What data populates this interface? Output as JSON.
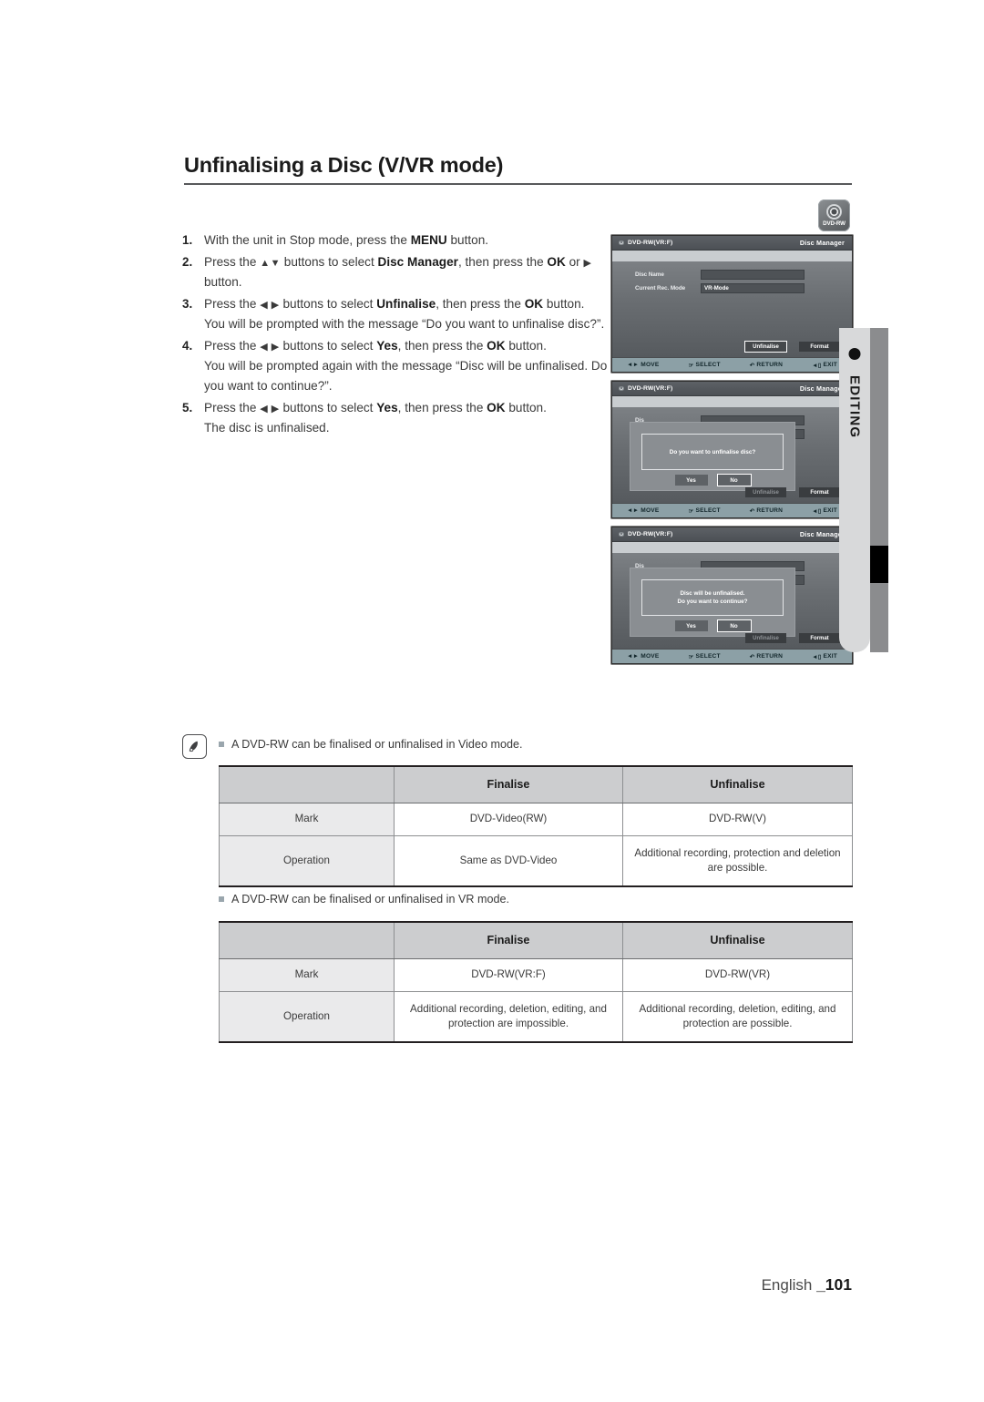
{
  "page": {
    "title": "Unfinalising a Disc (V/VR mode)",
    "footer_language": "English ",
    "footer_page": "_101"
  },
  "sidebar": {
    "label": "EDITING",
    "badge_label": "DVD-RW"
  },
  "steps": [
    {
      "num": "1.",
      "parts": [
        {
          "t": "With the unit in Stop mode, press the ",
          "b": false
        },
        {
          "t": "MENU",
          "b": true
        },
        {
          "t": " button.",
          "b": false
        }
      ]
    },
    {
      "num": "2.",
      "parts": [
        {
          "t": "Press the ",
          "b": false
        },
        {
          "t": "▲▼",
          "b": false
        },
        {
          "t": " buttons to select ",
          "b": false
        },
        {
          "t": "Disc Manager",
          "b": true
        },
        {
          "t": ", then press the ",
          "b": false
        },
        {
          "t": "OK",
          "b": true
        },
        {
          "t": " or ",
          "b": false
        },
        {
          "t": "▶",
          "b": false
        },
        {
          "t": " button.",
          "b": false
        }
      ]
    },
    {
      "num": "3.",
      "parts": [
        {
          "t": "Press the ",
          "b": false
        },
        {
          "t": "◀ ▶",
          "b": false
        },
        {
          "t": " buttons to select ",
          "b": false
        },
        {
          "t": "Unfinalise",
          "b": true
        },
        {
          "t": ", then press the ",
          "b": false
        },
        {
          "t": "OK",
          "b": true
        },
        {
          "t": " button.",
          "b": false
        },
        {
          "t": "\n",
          "b": false
        },
        {
          "t": "You will be prompted with the message “Do you want to unfinalise disc?”.",
          "b": false
        }
      ]
    },
    {
      "num": "4.",
      "parts": [
        {
          "t": "Press the ",
          "b": false
        },
        {
          "t": "◀ ▶",
          "b": false
        },
        {
          "t": " buttons to select ",
          "b": false
        },
        {
          "t": "Yes",
          "b": true
        },
        {
          "t": ", then press the ",
          "b": false
        },
        {
          "t": "OK",
          "b": true
        },
        {
          "t": " button.",
          "b": false
        },
        {
          "t": "\n",
          "b": false
        },
        {
          "t": "You will be prompted again with the message “Disc will be unfinalised. Do you want to continue?”.",
          "b": false
        }
      ]
    },
    {
      "num": "5.",
      "parts": [
        {
          "t": "Press the ",
          "b": false
        },
        {
          "t": "◀ ▶",
          "b": false
        },
        {
          "t": " buttons to select ",
          "b": false
        },
        {
          "t": "Yes",
          "b": true
        },
        {
          "t": ", then press the ",
          "b": false
        },
        {
          "t": "OK",
          "b": true
        },
        {
          "t": " button.",
          "b": false
        },
        {
          "t": "\n",
          "b": false
        },
        {
          "t": "The disc is unfinalised.",
          "b": false
        }
      ]
    }
  ],
  "screens": {
    "common": {
      "disc_label": "DVD-RW(VR:F)",
      "header_right": "Disc Manager",
      "field_disc_name_label": "Disc Name",
      "field_disc_name_value": "",
      "field_rec_mode_label": "Current Rec. Mode",
      "field_rec_mode_value": "VR-Mode",
      "btn_unfinalise": "Unfinalise",
      "btn_format": "Format",
      "foot_move": "MOVE",
      "foot_select": "SELECT",
      "foot_return": "RETURN",
      "foot_exit": "EXIT",
      "ghost_disc": "Dis",
      "ghost_cur": "Cu"
    },
    "dialog1": {
      "line1": "Do you want to unfinalise disc?",
      "line2": "",
      "yes": "Yes",
      "no": "No"
    },
    "dialog2": {
      "line1": "Disc will be unfinalised.",
      "line2": "Do you want to continue?",
      "yes": "Yes",
      "no": "No"
    }
  },
  "notes": [
    "A DVD-RW can be finalised or unfinalised in Video mode.",
    "A DVD-RW can be finalised or unfinalised in VR mode."
  ],
  "tables": [
    {
      "headers": [
        "",
        "Finalise",
        "Unfinalise"
      ],
      "rows": [
        [
          "Mark",
          "DVD-Video(RW)",
          "DVD-RW(V)"
        ],
        [
          "Operation",
          "Same as DVD-Video",
          "Additional recording, protection and deletion are possible."
        ]
      ]
    },
    {
      "headers": [
        "",
        "Finalise",
        "Unfinalise"
      ],
      "rows": [
        [
          "Mark",
          "DVD-RW(VR:F)",
          "DVD-RW(VR)"
        ],
        [
          "Operation",
          "Additional recording, deletion, editing, and protection are impossible.",
          "Additional recording, deletion, editing, and protection are possible."
        ]
      ]
    }
  ]
}
